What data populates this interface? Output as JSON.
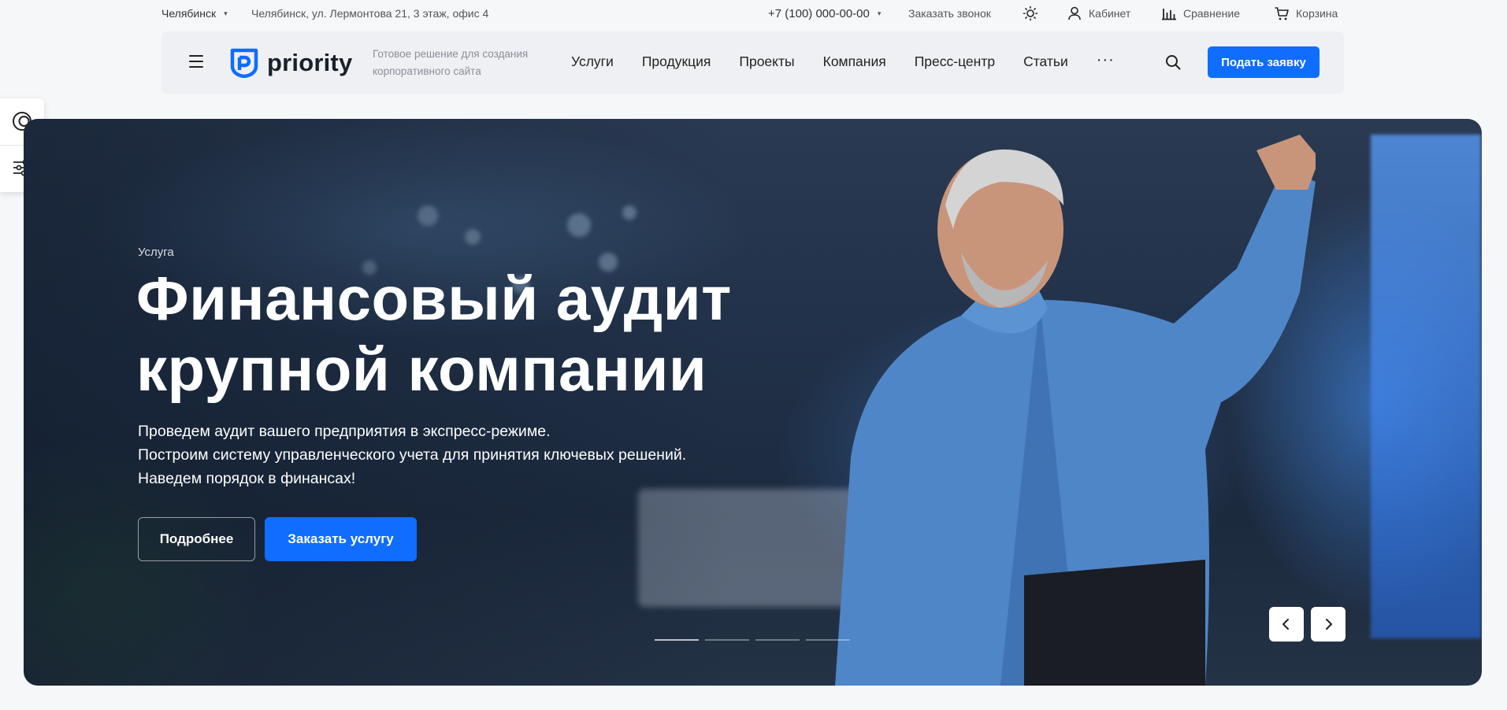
{
  "topbar": {
    "city": "Челябинск",
    "address": "Челябинск, ул. Лермонтова 21, 3 этаж, офис 4",
    "phone": "+7 (100) 000-00-00",
    "callback": "Заказать звонок",
    "cabinet": "Кабинет",
    "compare": "Сравнение",
    "cart": "Корзина"
  },
  "header": {
    "logo_text": "priority",
    "tagline": "Готовое решение для создания корпоративного сайта",
    "nav": [
      "Услуги",
      "Продукция",
      "Проекты",
      "Компания",
      "Пресс-центр",
      "Статьи"
    ],
    "more": "···",
    "cta": "Подать заявку"
  },
  "hero": {
    "eyebrow": "Услуга",
    "title_line1": "Финансовый аудит",
    "title_line2": "крупной компании",
    "desc_line1": "Проведем аудит вашего предприятия в экспресс-режиме.",
    "desc_line2": "Построим систему управленческого учета для принятия ключевых решений.",
    "desc_line3": "Наведем порядок в финансах!",
    "btn_more": "Подробнее",
    "btn_order": "Заказать услугу",
    "slides_total": 4,
    "slide_active": 1
  },
  "colors": {
    "accent": "#0f6dff",
    "background": "#f6f7f9",
    "header_bg": "#eef0f3"
  },
  "icons": {
    "theme": "sun-icon",
    "cabinet": "user-icon",
    "compare": "bar-chart-icon",
    "cart": "cart-icon",
    "search": "search-icon",
    "side_top": "contrast-icon",
    "side_bottom": "sliders-icon"
  }
}
